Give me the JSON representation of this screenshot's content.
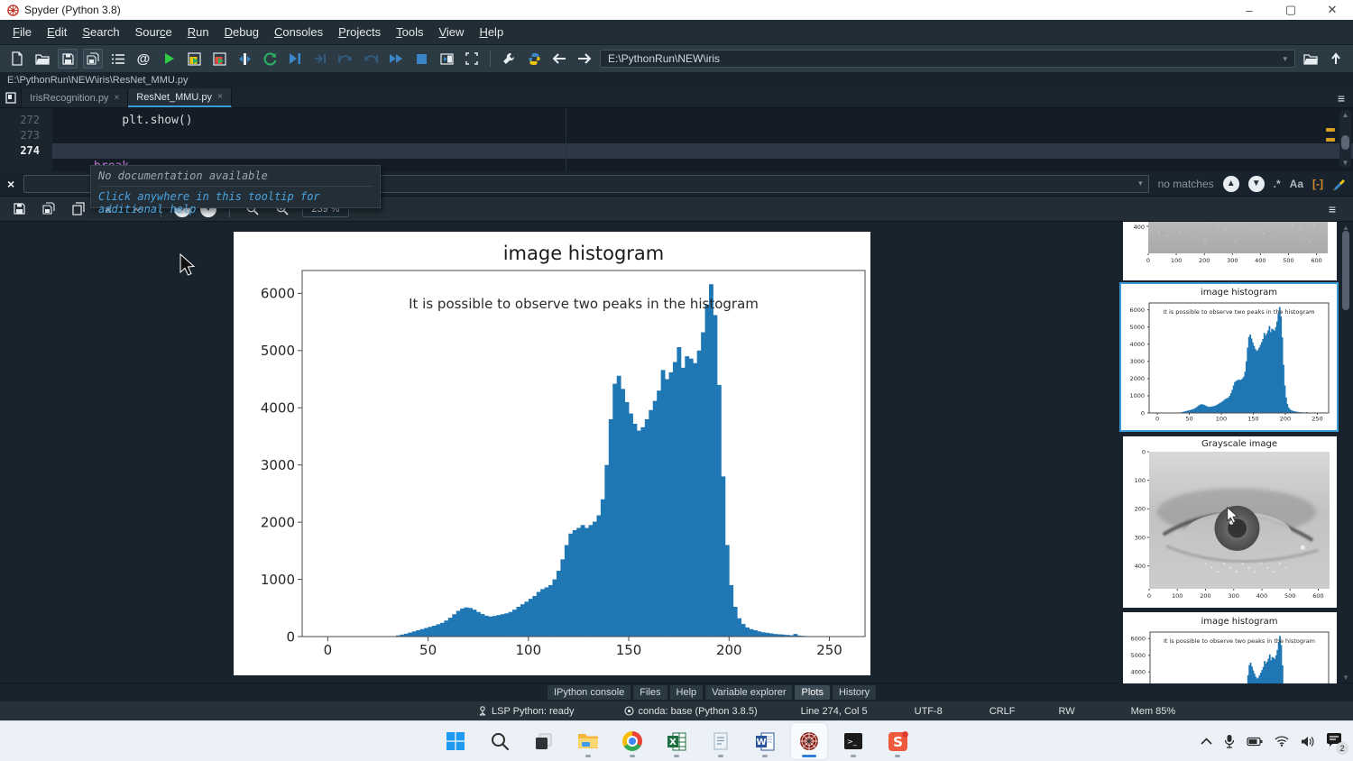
{
  "window": {
    "title": "Spyder (Python 3.8)",
    "controls": {
      "minimize": "–",
      "maximize": "▢",
      "close": "✕"
    }
  },
  "menu_items": [
    {
      "label": "File",
      "mnemonic": 0
    },
    {
      "label": "Edit",
      "mnemonic": 0
    },
    {
      "label": "Search",
      "mnemonic": 0
    },
    {
      "label": "Source",
      "mnemonic": 4
    },
    {
      "label": "Run",
      "mnemonic": 0
    },
    {
      "label": "Debug",
      "mnemonic": 0
    },
    {
      "label": "Consoles",
      "mnemonic": 0
    },
    {
      "label": "Projects",
      "mnemonic": 0
    },
    {
      "label": "Tools",
      "mnemonic": 0
    },
    {
      "label": "View",
      "mnemonic": 0
    },
    {
      "label": "Help",
      "mnemonic": 0
    }
  ],
  "toolbar": {
    "path_value": "E:\\PythonRun\\NEW\\iris"
  },
  "breadcrumb": "E:\\PythonRun\\NEW\\iris\\ResNet_MMU.py",
  "editor": {
    "tabs": [
      {
        "label": "IrisRecognition.py",
        "active": false
      },
      {
        "label": "ResNet_MMU.py",
        "active": true
      }
    ],
    "lines": [
      {
        "num": "272",
        "code": "    plt.show()",
        "current": false
      },
      {
        "num": "273",
        "code": "",
        "current": false
      },
      {
        "num": "274",
        "code": "",
        "current": true
      }
    ],
    "clipped_keyword": "break"
  },
  "find_bar": {
    "status": "no matches",
    "case_icon": "Aa",
    "regex_icon": ".*",
    "word_icon": "[-]"
  },
  "tooltip": {
    "line1": "No documentation available",
    "line2": "Click anywhere in this tooltip for additional help"
  },
  "plots_toolbar": {
    "zoom_value": "239 %"
  },
  "chart_data": {
    "type": "bar",
    "title": "image histogram",
    "annotation": "It is possible to observe two peaks in the histogram",
    "xlabel": "",
    "ylabel": "",
    "xlim": [
      -12.75,
      267.75
    ],
    "ylim": [
      0,
      6400
    ],
    "xticks": [
      0,
      50,
      100,
      150,
      200,
      250
    ],
    "yticks": [
      0,
      1000,
      2000,
      3000,
      4000,
      5000,
      6000
    ],
    "bar_color": "#1f77b4",
    "x_start": 34,
    "bin_width": 2,
    "values": [
      20,
      35,
      50,
      70,
      90,
      110,
      130,
      150,
      170,
      190,
      215,
      240,
      280,
      330,
      390,
      450,
      490,
      510,
      500,
      470,
      430,
      395,
      365,
      350,
      360,
      375,
      390,
      405,
      430,
      470,
      520,
      565,
      610,
      660,
      710,
      780,
      830,
      860,
      900,
      1000,
      1150,
      1350,
      1600,
      1800,
      1860,
      1900,
      1950,
      1900,
      1950,
      2010,
      2120,
      2400,
      3000,
      3800,
      4420,
      4560,
      4330,
      4100,
      3900,
      3720,
      3600,
      3660,
      3800,
      3960,
      4120,
      4300,
      4660,
      4500,
      4620,
      4800,
      5060,
      4700,
      4900,
      4860,
      4780,
      5000,
      5320,
      5800,
      6160,
      5620,
      4400,
      2800,
      1600,
      900,
      520,
      320,
      220,
      160,
      130,
      110,
      90,
      75,
      65,
      55,
      45,
      40,
      35,
      28,
      22,
      45,
      18,
      12
    ]
  },
  "thumbnails": {
    "strip": {
      "ytick": "400",
      "xticks": [
        0,
        100,
        200,
        300,
        400,
        500,
        600
      ]
    },
    "histogram": {
      "title": "image histogram"
    },
    "grayscale": {
      "title": "Grayscale image",
      "yticks": [
        0,
        100,
        200,
        300,
        400
      ],
      "xticks": [
        0,
        100,
        200,
        300,
        400,
        500,
        600
      ]
    },
    "histogram2": {
      "title": "image histogram"
    }
  },
  "bottom_tabs": [
    {
      "label": "IPython console",
      "active": false
    },
    {
      "label": "Files",
      "active": false
    },
    {
      "label": "Help",
      "active": false
    },
    {
      "label": "Variable explorer",
      "active": false
    },
    {
      "label": "Plots",
      "active": true
    },
    {
      "label": "History",
      "active": false
    }
  ],
  "status_bar": {
    "lsp": "LSP Python: ready",
    "conda": "conda: base (Python 3.8.5)",
    "position": "Line 274, Col 5",
    "encoding": "UTF-8",
    "eol": "CRLF",
    "permissions": "RW",
    "memory": "Mem 85%"
  },
  "icons": {
    "at_symbol": "@",
    "hamburger": "≡",
    "close": "×",
    "chevron_down": "▾",
    "excel_letter": "X",
    "word_letter": "W",
    "s_app_letter": "S",
    "terminal_prompt": ">_"
  },
  "tray": {
    "notification_count": "2"
  },
  "colors": {
    "accent": "#3b9ad9",
    "histogram_blue": "#1f77b4",
    "selection_border": "#3b9ad9",
    "keyword": "#c678dd",
    "warning_flag": "#d7a023"
  }
}
